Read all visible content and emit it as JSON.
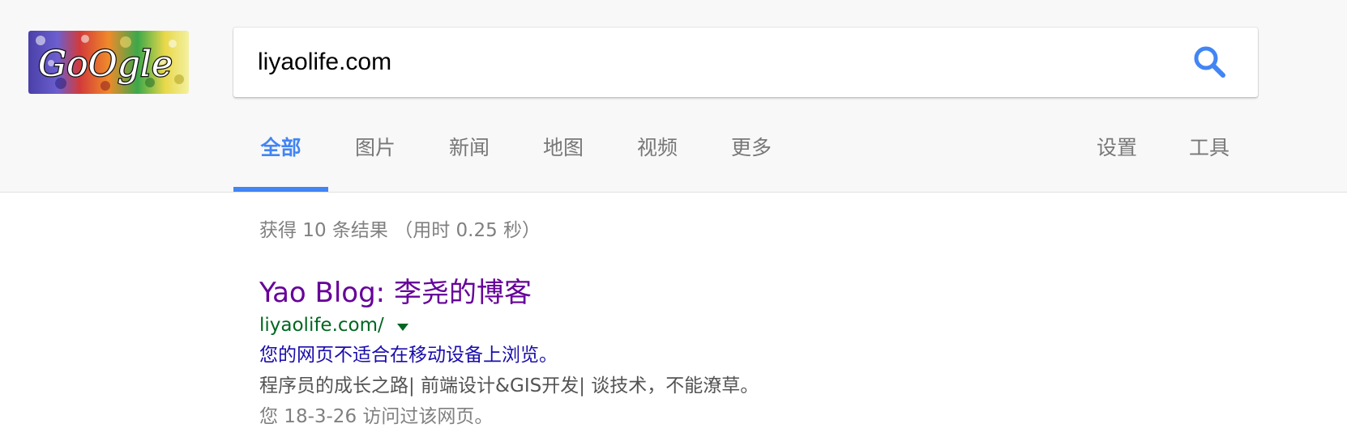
{
  "logo": {
    "text": "GoOgle"
  },
  "search": {
    "query": "liyaolife.com",
    "icon": "search-icon",
    "icon_color": "#4285f4"
  },
  "tabs": [
    {
      "label": "全部",
      "active": true
    },
    {
      "label": "图片",
      "active": false
    },
    {
      "label": "新闻",
      "active": false
    },
    {
      "label": "地图",
      "active": false
    },
    {
      "label": "视频",
      "active": false
    },
    {
      "label": "更多",
      "active": false
    }
  ],
  "tools": {
    "settings": "设置",
    "tools": "工具"
  },
  "stats": "获得 10 条结果 （用时 0.25 秒）",
  "result": {
    "title": "Yao Blog: 李尧的博客",
    "url": "liyaolife.com/",
    "mobile_notice": "您的网页不适合在移动设备上浏览。",
    "snippet": "程序员的成长之路| 前端设计&GIS开发| 谈技术，不能潦草。",
    "visited": "您 18-3-26 访问过该网页。"
  },
  "colors": {
    "accent": "#4285f4",
    "title_visited": "#660099",
    "url_green": "#006621",
    "link_blue": "#1a0dab",
    "header_bg": "#f8f8f8"
  }
}
